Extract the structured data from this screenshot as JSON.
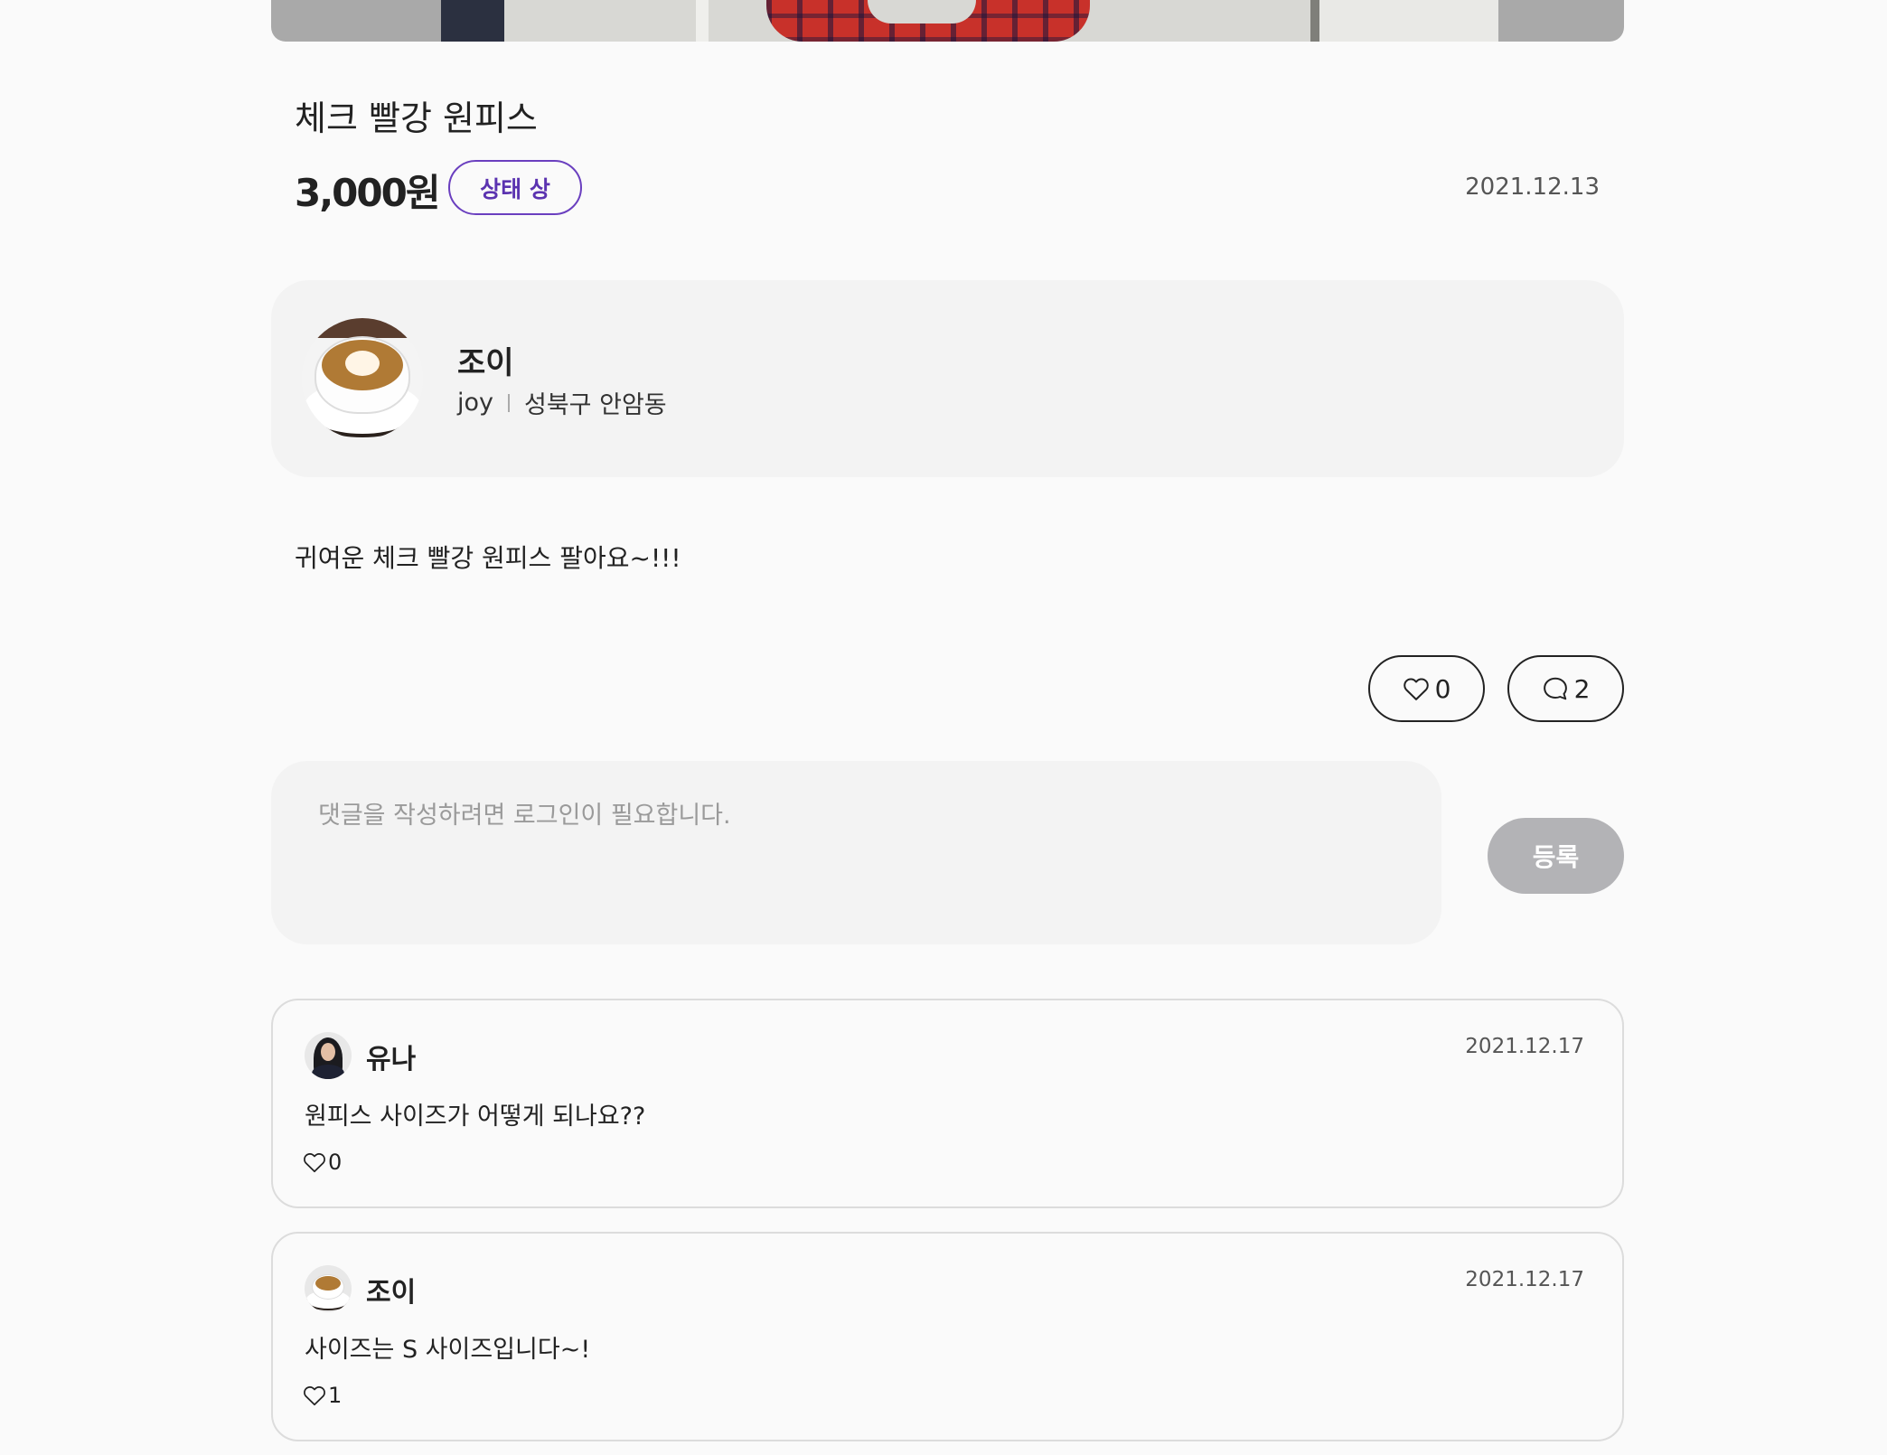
{
  "product": {
    "title": "체크 빨강 원피스",
    "price": "3,000원",
    "status_badge": "상태 상",
    "date": "2021.12.13",
    "description": "귀여운 체크 빨강 원피스 팔아요~!!!"
  },
  "seller": {
    "name": "조이",
    "id": "joy",
    "location": "성북구 안암동",
    "avatar_icon": "coffee-cup-avatar"
  },
  "stats": {
    "likes": "0",
    "comments": "2",
    "like_icon": "heart-icon",
    "comment_icon": "speech-bubble-icon"
  },
  "comment_form": {
    "placeholder": "댓글을 작성하려면 로그인이 필요합니다.",
    "submit_label": "등록"
  },
  "comments": [
    {
      "author": "유나",
      "date": "2021.12.17",
      "text": "원피스 사이즈가 어떻게 되나요??",
      "likes": "0",
      "avatar_icon": "person-avatar"
    },
    {
      "author": "조이",
      "date": "2021.12.17",
      "text": "사이즈는 S 사이즈입니다~!",
      "likes": "1",
      "avatar_icon": "coffee-cup-avatar"
    }
  ],
  "colors": {
    "accent": "#5b33b0",
    "background": "#fafafa",
    "card": "#f3f3f3",
    "button_disabled": "#b3b3b6"
  }
}
